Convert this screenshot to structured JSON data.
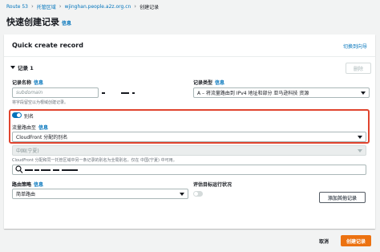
{
  "breadcrumb": {
    "items": [
      "Route 53",
      "托管区域",
      "wjinghan.people.a2z.org.cn",
      "创建记录"
    ]
  },
  "page": {
    "title": "快速创建记录",
    "info": "信息"
  },
  "card": {
    "title": "Quick create record",
    "switch_wizard": "切换到向导"
  },
  "record": {
    "header": "记录 1",
    "delete_label": "删除",
    "name_label": "记录名称",
    "name_info": "信息",
    "name_placeholder": "subdomain",
    "name_hint": "将字段留空以为根域创建记录。",
    "type_label": "记录类型",
    "type_info": "信息",
    "type_value": "A – 将流量路由到 IPv4 地址和部分 亚马逊科技 资源"
  },
  "alias": {
    "toggle_label": "别名",
    "toggle_on": true,
    "route_label": "流量路由至",
    "route_info": "信息",
    "route_value": "CloudFront 分配的别名",
    "region_value": "中国(宁夏)",
    "region_hint": "CloudFront 分配和同一托管区域中另一条记录的别名为全局别名，仅在 中国(宁夏) 中可用。"
  },
  "routing": {
    "policy_label": "路由策略",
    "policy_info": "信息",
    "policy_value": "简单路由",
    "health_label": "评估目标运行状况",
    "health_on": false
  },
  "actions": {
    "add_label": "添加其他记录",
    "cancel_label": "取消",
    "create_label": "创建记录"
  },
  "colors": {
    "accent": "#0073bb",
    "primary_button": "#ec7211",
    "highlight_border": "#e0452f"
  }
}
